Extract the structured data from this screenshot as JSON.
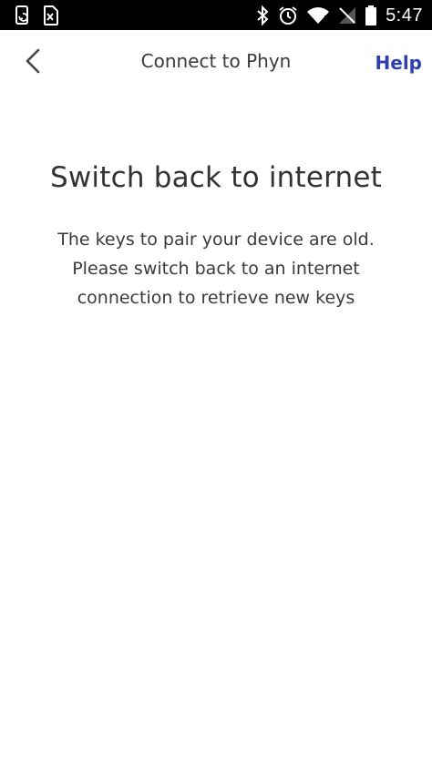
{
  "status_bar": {
    "time": "5:47",
    "icons": [
      "phone-sync-icon",
      "sim-card-x-icon",
      "bluetooth-icon",
      "alarm-icon",
      "wifi-icon",
      "no-signal-icon",
      "battery-icon"
    ]
  },
  "app_bar": {
    "title": "Connect to Phyn",
    "help_label": "Help",
    "back_icon": "chevron-left-icon",
    "help_color": "#2f3fae"
  },
  "main": {
    "heading": "Switch back to internet",
    "message": "The keys to pair your device are old. Please switch back to an internet connection to retrieve new keys"
  }
}
